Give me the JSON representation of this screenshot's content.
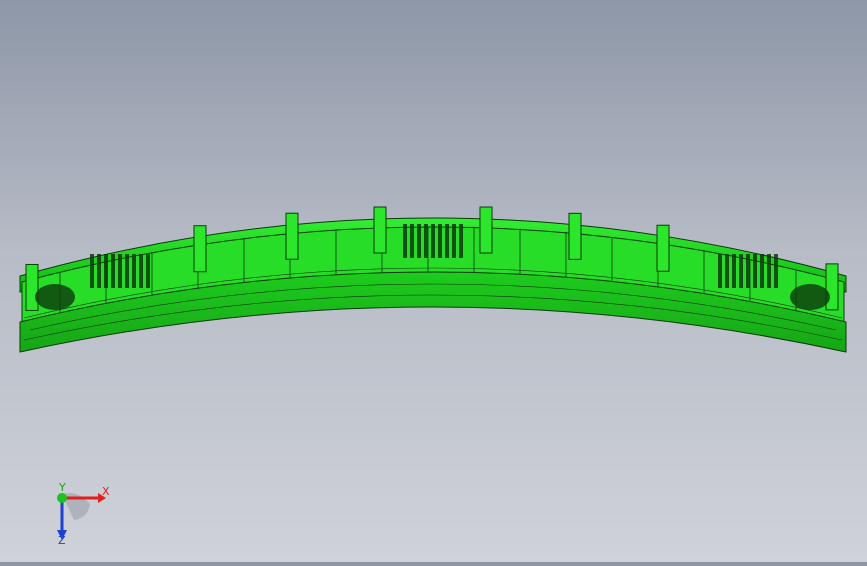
{
  "viewport": {
    "model": "curved-green-bracket-part",
    "colors": {
      "background_top": "#8e97a8",
      "background_bottom": "#cfd2d9",
      "part_fill": "#22dd22",
      "part_shadow": "#14a814",
      "edge": "#0a3a0a"
    }
  },
  "triad": {
    "x_label": "X",
    "y_label": "Y",
    "z_label": "Z",
    "colors": {
      "x": "#e02020",
      "y": "#20c020",
      "z": "#2040d0"
    }
  }
}
